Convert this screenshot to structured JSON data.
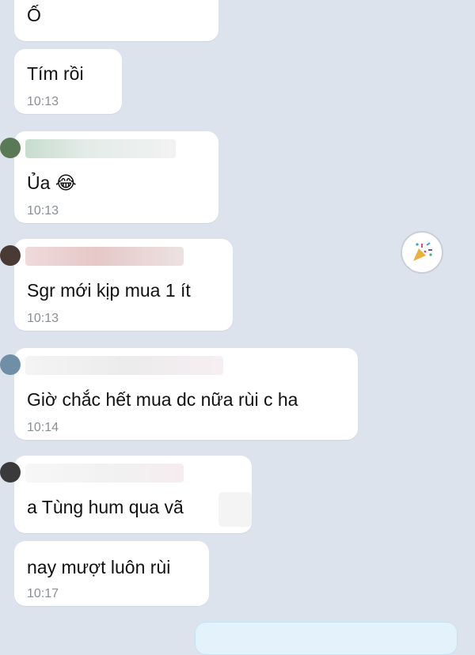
{
  "messages": [
    {
      "text": "Ố",
      "time": ""
    },
    {
      "text": "Tím rồi",
      "time": "10:13"
    },
    {
      "text": "Ủa",
      "emoji": "😂",
      "time": "10:13"
    },
    {
      "text": "Sgr mới kịp mua 1 ít",
      "time": "10:13"
    },
    {
      "text": "Giờ chắc hết mua dc nữa rùi c ha",
      "time": "10:14"
    },
    {
      "text": "a Tùng hum qua vã",
      "time": ""
    },
    {
      "text": "nay mượt luôn rùi",
      "time": "10:17"
    }
  ],
  "colors": {
    "background": "#dde3ec",
    "bubble_incoming": "#ffffff",
    "bubble_outgoing": "#e4f2fb",
    "time_text": "#8a8f96"
  },
  "icons": {
    "reaction_button": "party-popper-icon"
  }
}
